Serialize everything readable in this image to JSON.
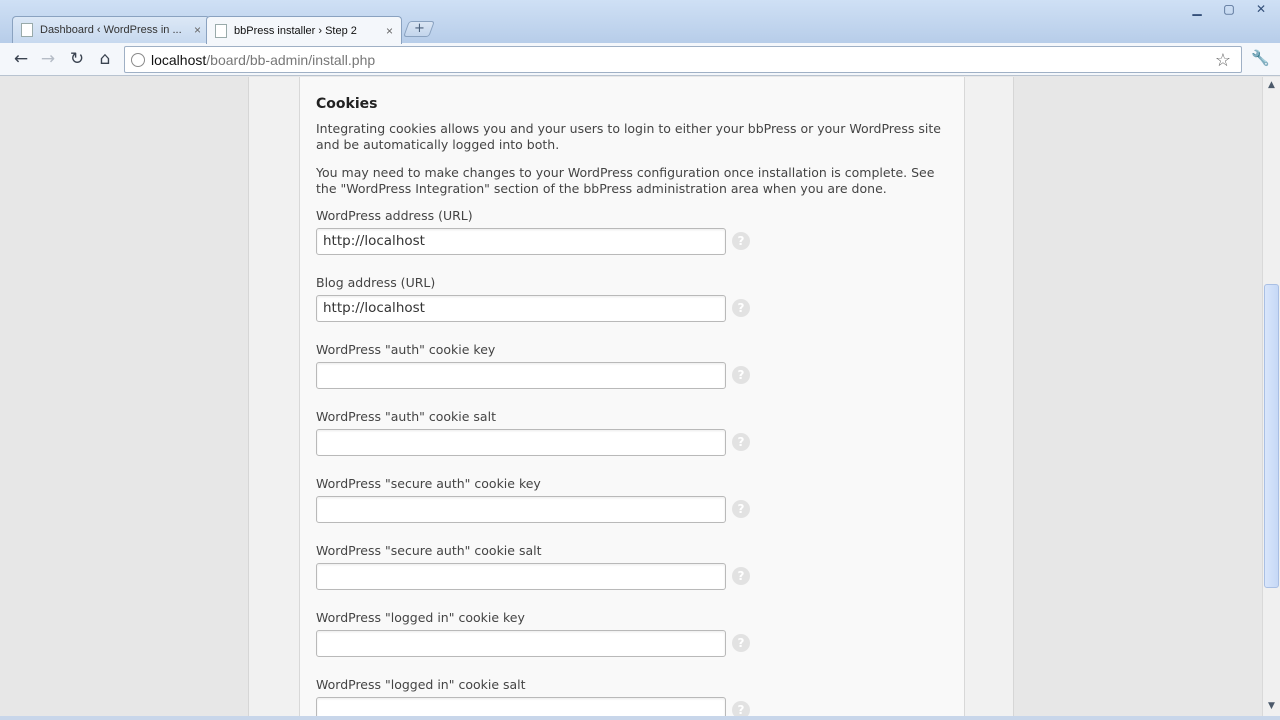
{
  "browser": {
    "tabs": [
      {
        "title": "Dashboard ‹ WordPress in ...",
        "close": "×",
        "active": false
      },
      {
        "title": "bbPress installer › Step 2",
        "close": "×",
        "active": true
      }
    ],
    "new_tab_glyph": "+",
    "window_buttons": {
      "minimize": "▁",
      "maximize": "▢",
      "close": "✕"
    },
    "nav": {
      "back": "←",
      "forward": "→",
      "reload": "↻",
      "home": "⌂"
    },
    "url_host": "localhost",
    "url_path": "/board/bb-admin/install.php",
    "bookmark_glyph": "☆",
    "wrench_glyph": "🔧"
  },
  "page": {
    "section_title": "Cookies",
    "intro_paragraph": "Integrating cookies allows you and your users to login to either your bbPress or your WordPress site and be automatically logged into both.",
    "note_paragraph": "You may need to make changes to your WordPress configuration once installation is complete. See the \"WordPress Integration\" section of the bbPress administration area when you are done.",
    "help_glyph": "?",
    "fields": [
      {
        "label": "WordPress address (URL)",
        "value": "http://localhost"
      },
      {
        "label": "Blog address (URL)",
        "value": "http://localhost"
      },
      {
        "label": "WordPress \"auth\" cookie key",
        "value": ""
      },
      {
        "label": "WordPress \"auth\" cookie salt",
        "value": ""
      },
      {
        "label": "WordPress \"secure auth\" cookie key",
        "value": ""
      },
      {
        "label": "WordPress \"secure auth\" cookie salt",
        "value": ""
      },
      {
        "label": "WordPress \"logged in\" cookie key",
        "value": ""
      },
      {
        "label": "WordPress \"logged in\" cookie salt",
        "value": ""
      }
    ]
  },
  "scrollbar": {
    "up": "▲",
    "down": "▼",
    "position_fraction": 0.38
  },
  "colors": {
    "titlebar": "#b7cde9",
    "page_background": "#e7e7e7",
    "panel": "#f9f9f9",
    "help_icon": "#e2e2e2"
  }
}
